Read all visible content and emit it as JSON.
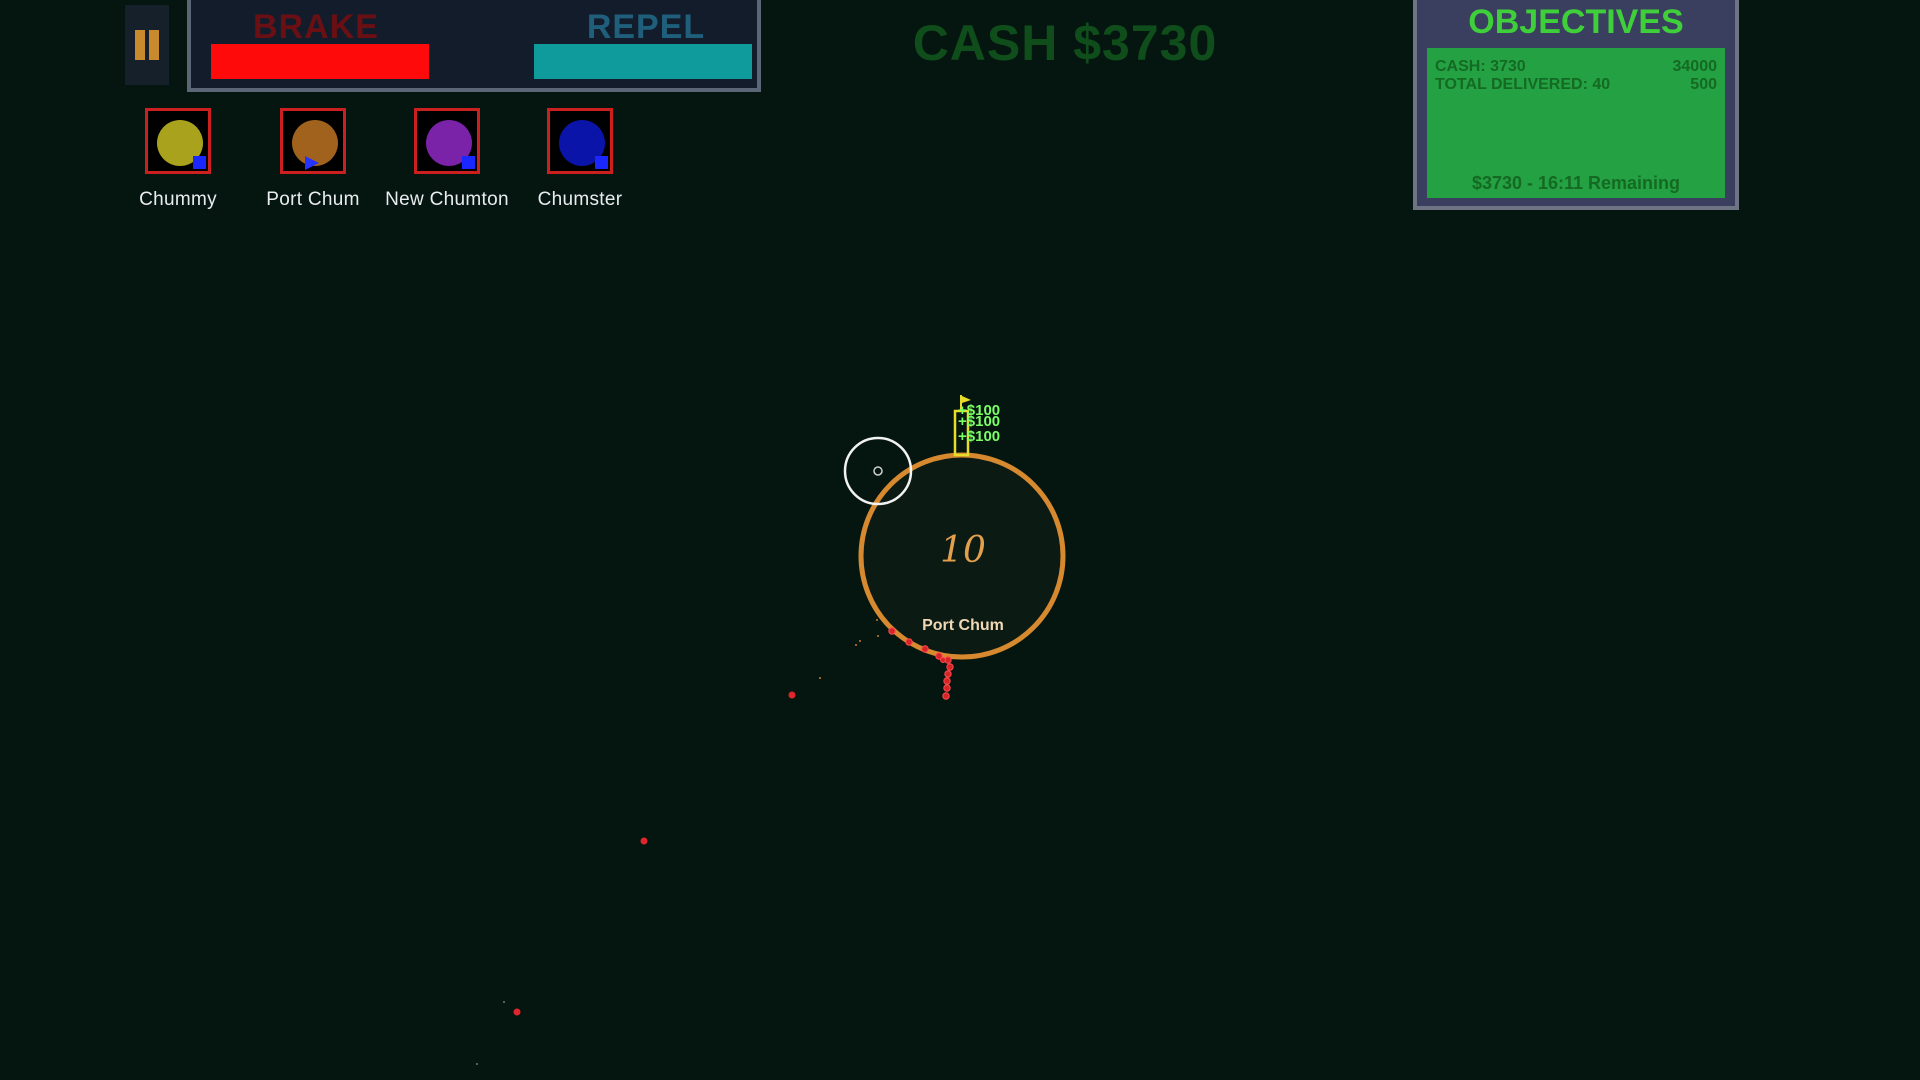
{
  "hud": {
    "pause_icon": "pause-icon",
    "abilities": {
      "brake_label": "BRAKE",
      "brake_level": 1.0,
      "repel_label": "REPEL",
      "repel_level": 1.0
    },
    "cash_display": "CASH $3730"
  },
  "objectives": {
    "title": "OBJECTIVES",
    "rows": [
      {
        "label": "CASH: 3730",
        "target": "34000"
      },
      {
        "label": "TOTAL DELIVERED: 40",
        "target": "500"
      }
    ],
    "footer": "$3730 - 16:11 Remaining"
  },
  "towns": [
    {
      "name": "Chummy",
      "color": "#a9a21d",
      "marker": "square"
    },
    {
      "name": "Port Chum",
      "color": "#a0621c",
      "marker": "triangle"
    },
    {
      "name": "New Chumton",
      "color": "#7a22a8",
      "marker": "square"
    },
    {
      "name": "Chumster",
      "color": "#0a14a8",
      "marker": "square"
    }
  ],
  "world": {
    "port": {
      "name": "Port Chum",
      "count": "10",
      "ring_color": "#d6892e"
    },
    "rewards": [
      "+$100",
      "+$100",
      "+$100"
    ]
  }
}
